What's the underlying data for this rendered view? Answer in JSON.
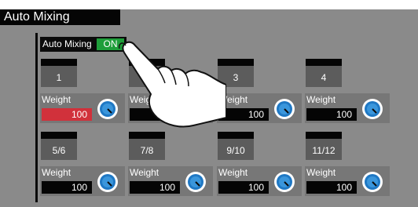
{
  "header": {
    "title": "Auto Mixing"
  },
  "auto_mixing": {
    "label": "Auto Mixing",
    "state": "ON"
  },
  "channels": [
    {
      "name": "1",
      "weight_label": "Weight",
      "weight": "100",
      "selected": true
    },
    {
      "name": "",
      "weight_label": "Weight",
      "weight": "100",
      "selected": false
    },
    {
      "name": "3",
      "weight_label": "Weight",
      "weight": "100",
      "selected": false
    },
    {
      "name": "4",
      "weight_label": "Weight",
      "weight": "100",
      "selected": false
    },
    {
      "name": "5/6",
      "weight_label": "Weight",
      "weight": "100",
      "selected": false
    },
    {
      "name": "7/8",
      "weight_label": "Weight",
      "weight": "100",
      "selected": false
    },
    {
      "name": "9/10",
      "weight_label": "Weight",
      "weight": "100",
      "selected": false
    },
    {
      "name": "11/12",
      "weight_label": "Weight",
      "weight": "100",
      "selected": false
    }
  ],
  "colors": {
    "panel_bg": "#8a8a8a",
    "on_green": "#1e9e3a",
    "selected_red": "#d1313b",
    "knob_blue": "#1f78c4"
  },
  "icons": {
    "knob": "rotary-knob-icon",
    "pointer": "tapping-hand-icon"
  }
}
